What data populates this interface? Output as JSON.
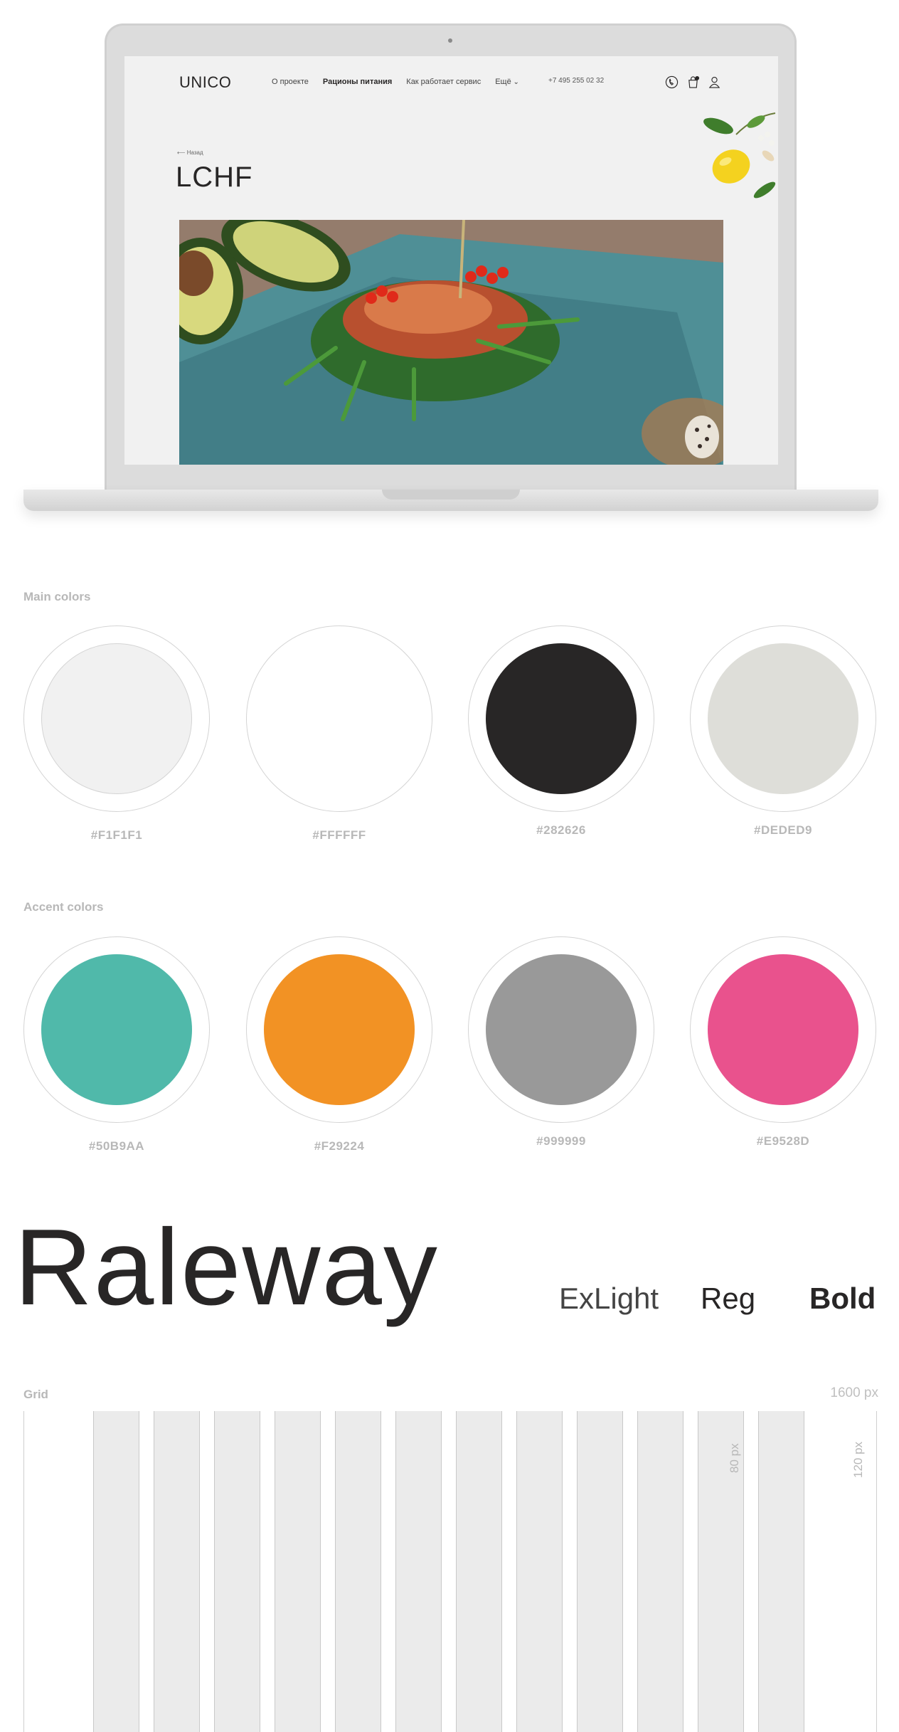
{
  "mockup": {
    "logo": "UNICO",
    "nav": [
      "О проекте",
      "Рационы питания",
      "Как работает сервис",
      "Ещё"
    ],
    "phone": "+7 495 255 02 32",
    "back_link": "⟵ Назад",
    "page_title": "LCHF",
    "icons": [
      "phone-icon",
      "cart-icon",
      "user-icon"
    ]
  },
  "main_colors": {
    "label": "Main colors",
    "swatches": [
      {
        "hex": "#F1F1F1",
        "color": "#F1F1F1"
      },
      {
        "hex": "#FFFFFF",
        "color": "#FFFFFF"
      },
      {
        "hex": "#282626",
        "color": "#282626"
      },
      {
        "hex": "#DEDED9",
        "color": "#DEDED9"
      }
    ]
  },
  "accent_colors": {
    "label": "Accent colors",
    "swatches": [
      {
        "hex": "#50B9AA",
        "color": "#50B9AA"
      },
      {
        "hex": "#F29224",
        "color": "#F29224"
      },
      {
        "hex": "#999999",
        "color": "#999999"
      },
      {
        "hex": "#E9528D",
        "color": "#E9528D"
      }
    ]
  },
  "typography": {
    "font_name": "Raleway",
    "weights": [
      "ExLight",
      "Reg",
      "Bold"
    ]
  },
  "grid": {
    "label": "Grid",
    "width": "1600 px",
    "column_width": "80 px",
    "margin_width": "120 px"
  }
}
